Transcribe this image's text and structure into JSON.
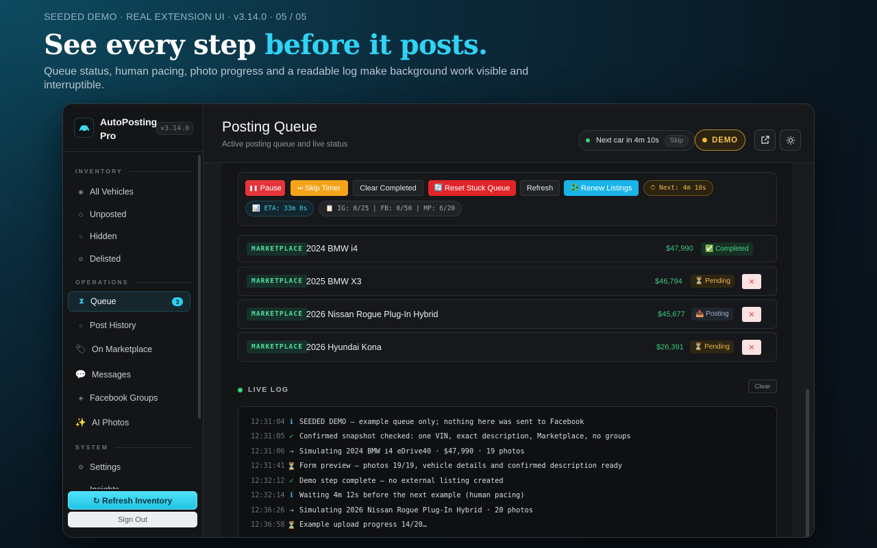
{
  "hero": {
    "eyebrow": "SEEDED DEMO · REAL EXTENSION UI · v3.14.0 · 05 / 05",
    "headline_plain": "See every step ",
    "headline_accent": "before it posts.",
    "subhead": "Queue status, human pacing, photo progress and a readable log make background work visible and interruptible."
  },
  "app": {
    "name": "AutoPosting Pro",
    "version": "v3.14.0",
    "logo_icon": "car-icon"
  },
  "sidebar": {
    "sections": {
      "inventory": "INVENTORY",
      "operations": "OPERATIONS",
      "system": "SYSTEM"
    },
    "items": [
      {
        "label": "All Vehicles",
        "icon": "◉"
      },
      {
        "label": "Unposted",
        "icon": "◇"
      },
      {
        "label": "Hidden",
        "icon": "○"
      },
      {
        "label": "Delisted",
        "icon": "⊘"
      },
      {
        "label": "Queue",
        "icon": "⧗",
        "badge": "3",
        "active": true
      },
      {
        "label": "Post History",
        "icon": "○"
      },
      {
        "label": "On Marketplace",
        "icon": "🏷"
      },
      {
        "label": "Messages",
        "icon": "💬"
      },
      {
        "label": "Facebook Groups",
        "icon": "◈"
      },
      {
        "label": "AI Photos",
        "icon": "✨"
      },
      {
        "label": "Settings",
        "icon": "⚙"
      },
      {
        "label": "Insights",
        "icon": "◦"
      }
    ],
    "refresh_label": "↻ Refresh Inventory",
    "signout_label": "Sign Out"
  },
  "header": {
    "title": "Posting Queue",
    "subtitle": "Active posting queue and live status",
    "next_car": "Next car in 4m 10s",
    "skip_label": "Skip",
    "demo_label": "DEMO",
    "external_icon": "external-link-icon",
    "theme_icon": "sun-icon"
  },
  "controls": {
    "pause": "Pause",
    "skip_timer": "Skip Timer",
    "clear_completed": "Clear Completed",
    "reset_stuck": "Reset Stuck Queue",
    "refresh": "Refresh",
    "renew_listings": "Renew Listings",
    "next_timer": "⏱ Next: 4m 10s",
    "eta": "📊 ETA: 33m 0s",
    "counts": "📋 IG: 0/25 | FB: 0/50 | MP: 6/20",
    "colors": {
      "pause": "#e5343a",
      "skip": "#f5a31a",
      "reset": "#e0252b",
      "renew": "#18b4e8"
    }
  },
  "queue": [
    {
      "tag": "MARKETPLACE",
      "title": "2024 BMW i4",
      "price": "$47,990",
      "status": "✅ Completed",
      "removable": false
    },
    {
      "tag": "MARKETPLACE",
      "title": "2025 BMW X3",
      "price": "$46,794",
      "status": "⏳ Pending",
      "removable": true
    },
    {
      "tag": "MARKETPLACE",
      "title": "2026 Nissan Rogue Plug-In Hybrid",
      "price": "$45,677",
      "status": "📤 Posting",
      "removable": true
    },
    {
      "tag": "MARKETPLACE",
      "title": "2026 Hyundai Kona",
      "price": "$26,391",
      "status": "⏳ Pending",
      "removable": true
    }
  ],
  "log": {
    "title": "LIVE LOG",
    "clear_label": "Clear",
    "lines": [
      {
        "ts": "12:31:04",
        "sym": "ℹ",
        "text": "SEEDED DEMO — example queue only; nothing here was sent to Facebook"
      },
      {
        "ts": "12:31:05",
        "sym": "✓",
        "text": "Confirmed snapshot checked: one VIN, exact description, Marketplace, no groups"
      },
      {
        "ts": "12:31:06",
        "sym": "→",
        "text": "Simulating 2024 BMW i4 eDrive40 · $47,990 · 19 photos"
      },
      {
        "ts": "12:31:41",
        "sym": "⏳",
        "text": "Form preview — photos 19/19, vehicle details and confirmed description ready"
      },
      {
        "ts": "12:32:12",
        "sym": "✓",
        "text": "Demo step complete — no external listing created"
      },
      {
        "ts": "12:32:14",
        "sym": "ℹ",
        "text": "Waiting 4m 12s before the next example (human pacing)"
      },
      {
        "ts": "12:36:26",
        "sym": "→",
        "text": "Simulating 2026 Nissan Rogue Plug-In Hybrid · 20 photos"
      },
      {
        "ts": "12:36:58",
        "sym": "⏳",
        "text": "Example upload progress 14/20…"
      }
    ]
  }
}
